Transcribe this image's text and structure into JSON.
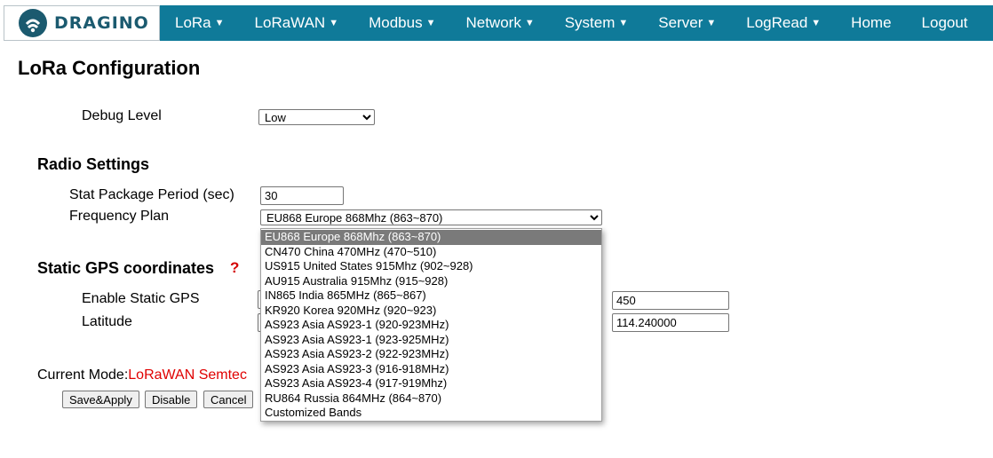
{
  "brand": {
    "name": "DRAGINO"
  },
  "nav": [
    {
      "label": "LoRa",
      "caret": "▼"
    },
    {
      "label": "LoRaWAN",
      "caret": "▼"
    },
    {
      "label": "Modbus",
      "caret": "▼"
    },
    {
      "label": "Network",
      "caret": "▼"
    },
    {
      "label": "System",
      "caret": "▼"
    },
    {
      "label": "Server",
      "caret": "▼"
    },
    {
      "label": "LogRead",
      "caret": "▼"
    },
    {
      "label": "Home",
      "caret": ""
    },
    {
      "label": "Logout",
      "caret": ""
    }
  ],
  "page": {
    "title": "LoRa Configuration"
  },
  "debug": {
    "label": "Debug Level",
    "value": "Low"
  },
  "radio": {
    "title": "Radio Settings",
    "stat_label": "Stat Package Period (sec)",
    "stat_value": "30",
    "freq_label": "Frequency Plan",
    "freq_value": "EU868 Europe 868Mhz (863~870)"
  },
  "gps": {
    "title": "Static GPS coordinates",
    "help": "?",
    "enable_label": "Enable Static GPS",
    "latitude_label": "Latitude",
    "altitude_value": "450",
    "longitude_value": "114.240000"
  },
  "mode": {
    "prefix": "Current Mode:",
    "value": "LoRaWAN Semtec"
  },
  "buttons": {
    "save": "Save&Apply",
    "disable": "Disable",
    "cancel": "Cancel"
  },
  "frequency_options": [
    "EU868 Europe 868Mhz (863~870)",
    "CN470 China 470MHz (470~510)",
    "US915 United States 915Mhz (902~928)",
    "AU915 Australia 915Mhz (915~928)",
    "IN865 India 865MHz (865~867)",
    "KR920 Korea 920MHz (920~923)",
    "AS923 Asia AS923-1 (920-923MHz)",
    "AS923 Asia AS923-1 (923-925MHz)",
    "AS923 Asia AS923-2 (922-923MHz)",
    "AS923 Asia AS923-3 (916-918MHz)",
    "AS923 Asia AS923-4 (917-919Mhz)",
    "RU864 Russia 864MHz (864~870)",
    "Customized Bands"
  ],
  "selected_option_index": 0,
  "colors": {
    "navbar": "#0f7a99",
    "brand_text": "#1b5a6f",
    "mode_value": "#e00000",
    "help": "#d40000",
    "selected_option": "#7a7a7a"
  }
}
